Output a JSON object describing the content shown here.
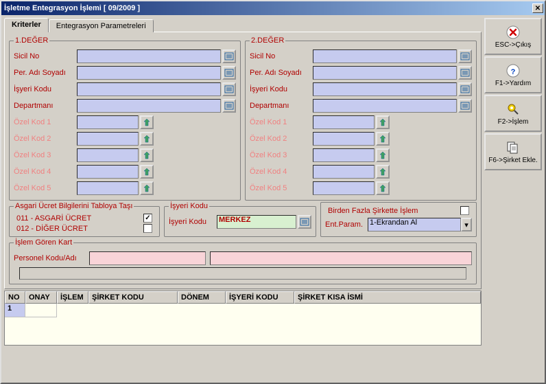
{
  "title": "İşletme Entegrasyon İşlemi [ 09/2009 ]",
  "tabs": {
    "t0": "Kriterler",
    "t1": "Entegrasyon Parametreleri"
  },
  "deger1": {
    "legend": "1.DEĞER",
    "sicil": "Sicil No",
    "per": "Per. Adı Soyadı",
    "isyeri": "İşyeri Kodu",
    "dep": "Departmanı",
    "o1": "Özel Kod 1",
    "o2": "Özel Kod 2",
    "o3": "Özel Kod 3",
    "o4": "Özel Kod 4",
    "o5": "Özel Kod 5"
  },
  "deger2": {
    "legend": "2.DEĞER",
    "sicil": "Sicil No",
    "per": "Per. Adı Soyadı",
    "isyeri": "İşyeri Kodu",
    "dep": "Departmanı",
    "o1": "Özel Kod 1",
    "o2": "Özel Kod 2",
    "o3": "Özel Kod 3",
    "o4": "Özel Kod 4",
    "o5": "Özel Kod 5"
  },
  "asgari": {
    "legend": "Asgari Ücret Bilgilerini Tabloya Taşı",
    "l1": "011 - ASGARİ ÜCRET",
    "l2": "012 - DİĞER ÜCRET"
  },
  "isyeriBox": {
    "legend": "İşyeri Kodu",
    "label": "İşyeri Kodu",
    "value": "MERKEZ"
  },
  "sirket": {
    "chk": "Birden Fazla Şirkette İşlem",
    "ent": "Ent.Param.",
    "entval": "1-Ekrandan Al"
  },
  "islem": {
    "legend": "İşlem Gören Kart",
    "label": "Personel Kodu/Adı"
  },
  "grid": {
    "h0": "NO",
    "h1": "ONAY",
    "h2": "İŞLEM",
    "h3": "ŞİRKET KODU",
    "h4": "DÖNEM",
    "h5": "İŞYERİ KODU",
    "h6": "ŞİRKET KISA İSMİ",
    "r0c0": "1"
  },
  "side": {
    "esc": "ESC->Çıkış",
    "f1": "F1->Yardım",
    "f2": "F2->İşlem",
    "f6": "F6->Şirket Ekle."
  }
}
